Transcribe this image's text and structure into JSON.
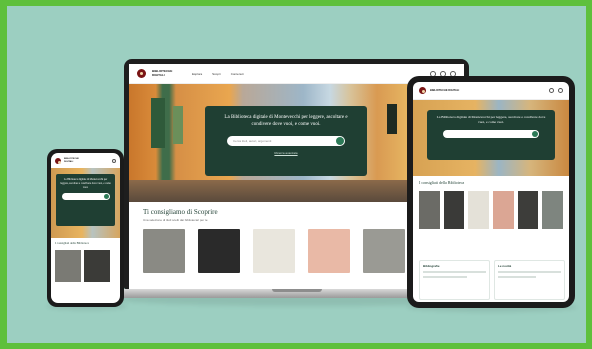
{
  "brand": {
    "logo_text": "BIBLIOTECHE DIGITALI",
    "accent": "#1f3f33",
    "button_color": "#2c7a57",
    "background": "#9ccfc1",
    "frame": "#5ec03c"
  },
  "laptop": {
    "nav_items": [
      "Esplora",
      "Scopri",
      "Contenuti"
    ],
    "hero_title": "La Biblioteca digitale di Montevecchi per leggere, ascoltare e condivere dove vuoi, e come vuoi.",
    "search_placeholder": "Cerca titoli, autori, argomenti",
    "hero_link": "Ricerca avanzata",
    "section_title": "Ti consigliamo di Scoprire",
    "section_subtitle": "Una selezione di titoli scelti dai bibliotecari per te",
    "book_colors": [
      "#8a8a84",
      "#2a2a2a",
      "#e9e6dd",
      "#e9b9a6",
      "#9a9a94"
    ]
  },
  "tablet": {
    "hero_title": "La Biblioteca digitale di Montevecchi per leggere, ascoltare e condivere dove vuoi, e come vuoi.",
    "section_title": "I consigliati della Biblioteca",
    "book_colors": [
      "#6b6b66",
      "#3a3a38",
      "#e4e1d8",
      "#dba694",
      "#3d3d3a",
      "#7e857f"
    ],
    "box_left_title": "Bibliografie",
    "box_right_title": "Le novità"
  },
  "phone": {
    "hero_title": "La Biblioteca digitale di Montevecchi per leggere, ascoltare e condivere dove vuoi, e come vuoi.",
    "section_title": "I consigliati della Biblioteca",
    "book_colors": [
      "#7a7a74",
      "#3b3b38"
    ]
  }
}
